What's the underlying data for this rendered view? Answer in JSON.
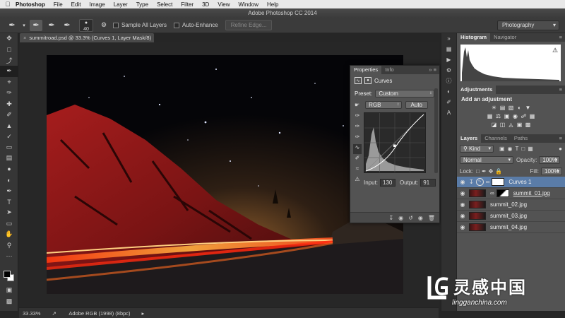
{
  "menubar": {
    "app": "Photoshop",
    "items": [
      "File",
      "Edit",
      "Image",
      "Layer",
      "Type",
      "Select",
      "Filter",
      "3D",
      "View",
      "Window",
      "Help"
    ]
  },
  "window_title": "Adobe Photoshop CC 2014",
  "options": {
    "brush_size": "40",
    "sample_all_layers": "Sample All Layers",
    "auto_enhance": "Auto-Enhance",
    "refine_edge": "Refine Edge...",
    "workspace": "Photography"
  },
  "document": {
    "tab_title": "summitroad.psd @ 33.3% (Curves 1, Layer Mask/8) *",
    "zoom": "33.33%",
    "color_profile": "Adobe RGB (1998) (8bpc)"
  },
  "properties": {
    "tabs": [
      "Properties",
      "Info"
    ],
    "title": "Curves",
    "preset_label": "Preset:",
    "preset_value": "Custom",
    "channel": "RGB",
    "auto_label": "Auto",
    "input_label": "Input:",
    "input_value": "130",
    "output_label": "Output:",
    "output_value": "91"
  },
  "histogram": {
    "tabs": [
      "Histogram",
      "Navigator"
    ]
  },
  "adjustments": {
    "tab": "Adjustments",
    "title": "Add an adjustment"
  },
  "layers_panel": {
    "tabs": [
      "Layers",
      "Channels",
      "Paths"
    ],
    "filter": "Kind",
    "blend_mode": "Normal",
    "opacity_label": "Opacity:",
    "opacity_value": "100%",
    "lock_label": "Lock:",
    "fill_label": "Fill:",
    "fill_value": "100%",
    "layers": [
      {
        "name": "Curves 1",
        "selected": true
      },
      {
        "name": "summit_01.jpg"
      },
      {
        "name": "summit_02.jpg"
      },
      {
        "name": "summit_03.jpg"
      },
      {
        "name": "summit_04.jpg"
      }
    ]
  },
  "watermark": {
    "brand": "灵感中国",
    "url": "lingganchina.com"
  }
}
